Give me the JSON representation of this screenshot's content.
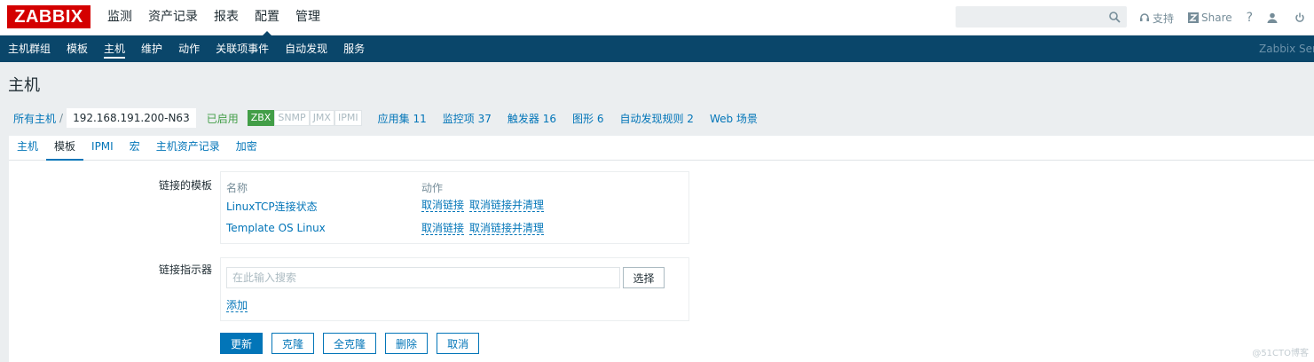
{
  "header": {
    "logo": "ZABBIX",
    "menu": [
      "监测",
      "资产记录",
      "报表",
      "配置",
      "管理"
    ],
    "active_menu_index": 3,
    "search_placeholder": "",
    "support": "支持",
    "share": "Share",
    "help": "?"
  },
  "subnav": {
    "items": [
      "主机群组",
      "模板",
      "主机",
      "维护",
      "动作",
      "关联项事件",
      "自动发现",
      "服务"
    ],
    "active_index": 2,
    "server": "Zabbix Serv"
  },
  "page": {
    "title": "主机"
  },
  "breadcrumb": {
    "all_hosts": "所有主机",
    "separator": "/",
    "host": "192.168.191.200-N63",
    "status": "已启用",
    "tags": [
      {
        "label": "ZBX",
        "active": true
      },
      {
        "label": "SNMP",
        "active": false
      },
      {
        "label": "JMX",
        "active": false
      },
      {
        "label": "IPMI",
        "active": false
      }
    ],
    "links": [
      {
        "label": "应用集",
        "count": "11"
      },
      {
        "label": "监控项",
        "count": "37"
      },
      {
        "label": "触发器",
        "count": "16"
      },
      {
        "label": "图形",
        "count": "6"
      },
      {
        "label": "自动发现规则",
        "count": "2"
      },
      {
        "label": "Web 场景",
        "count": ""
      }
    ]
  },
  "tabs": [
    "主机",
    "模板",
    "IPMI",
    "宏",
    "主机资产记录",
    "加密"
  ],
  "active_tab_index": 1,
  "form": {
    "linked_templates_label": "链接的模板",
    "col_name": "名称",
    "col_action": "动作",
    "templates": [
      {
        "name": "LinuxTCP连接状态",
        "unlink": "取消链接",
        "unlink_clear": "取消链接并清理"
      },
      {
        "name": "Template OS Linux",
        "unlink": "取消链接",
        "unlink_clear": "取消链接并清理"
      }
    ],
    "link_indicator_label": "链接指示器",
    "search_placeholder": "在此输入搜索",
    "select_label": "选择",
    "add_label": "添加"
  },
  "buttons": {
    "update": "更新",
    "clone": "克隆",
    "full_clone": "全克隆",
    "delete": "删除",
    "cancel": "取消"
  },
  "watermark": "@51CTO博客",
  "colors": {
    "brand_red": "#d40000",
    "nav_blue": "#0a466a",
    "link_blue": "#0275b8",
    "enabled_green": "#429e47"
  }
}
